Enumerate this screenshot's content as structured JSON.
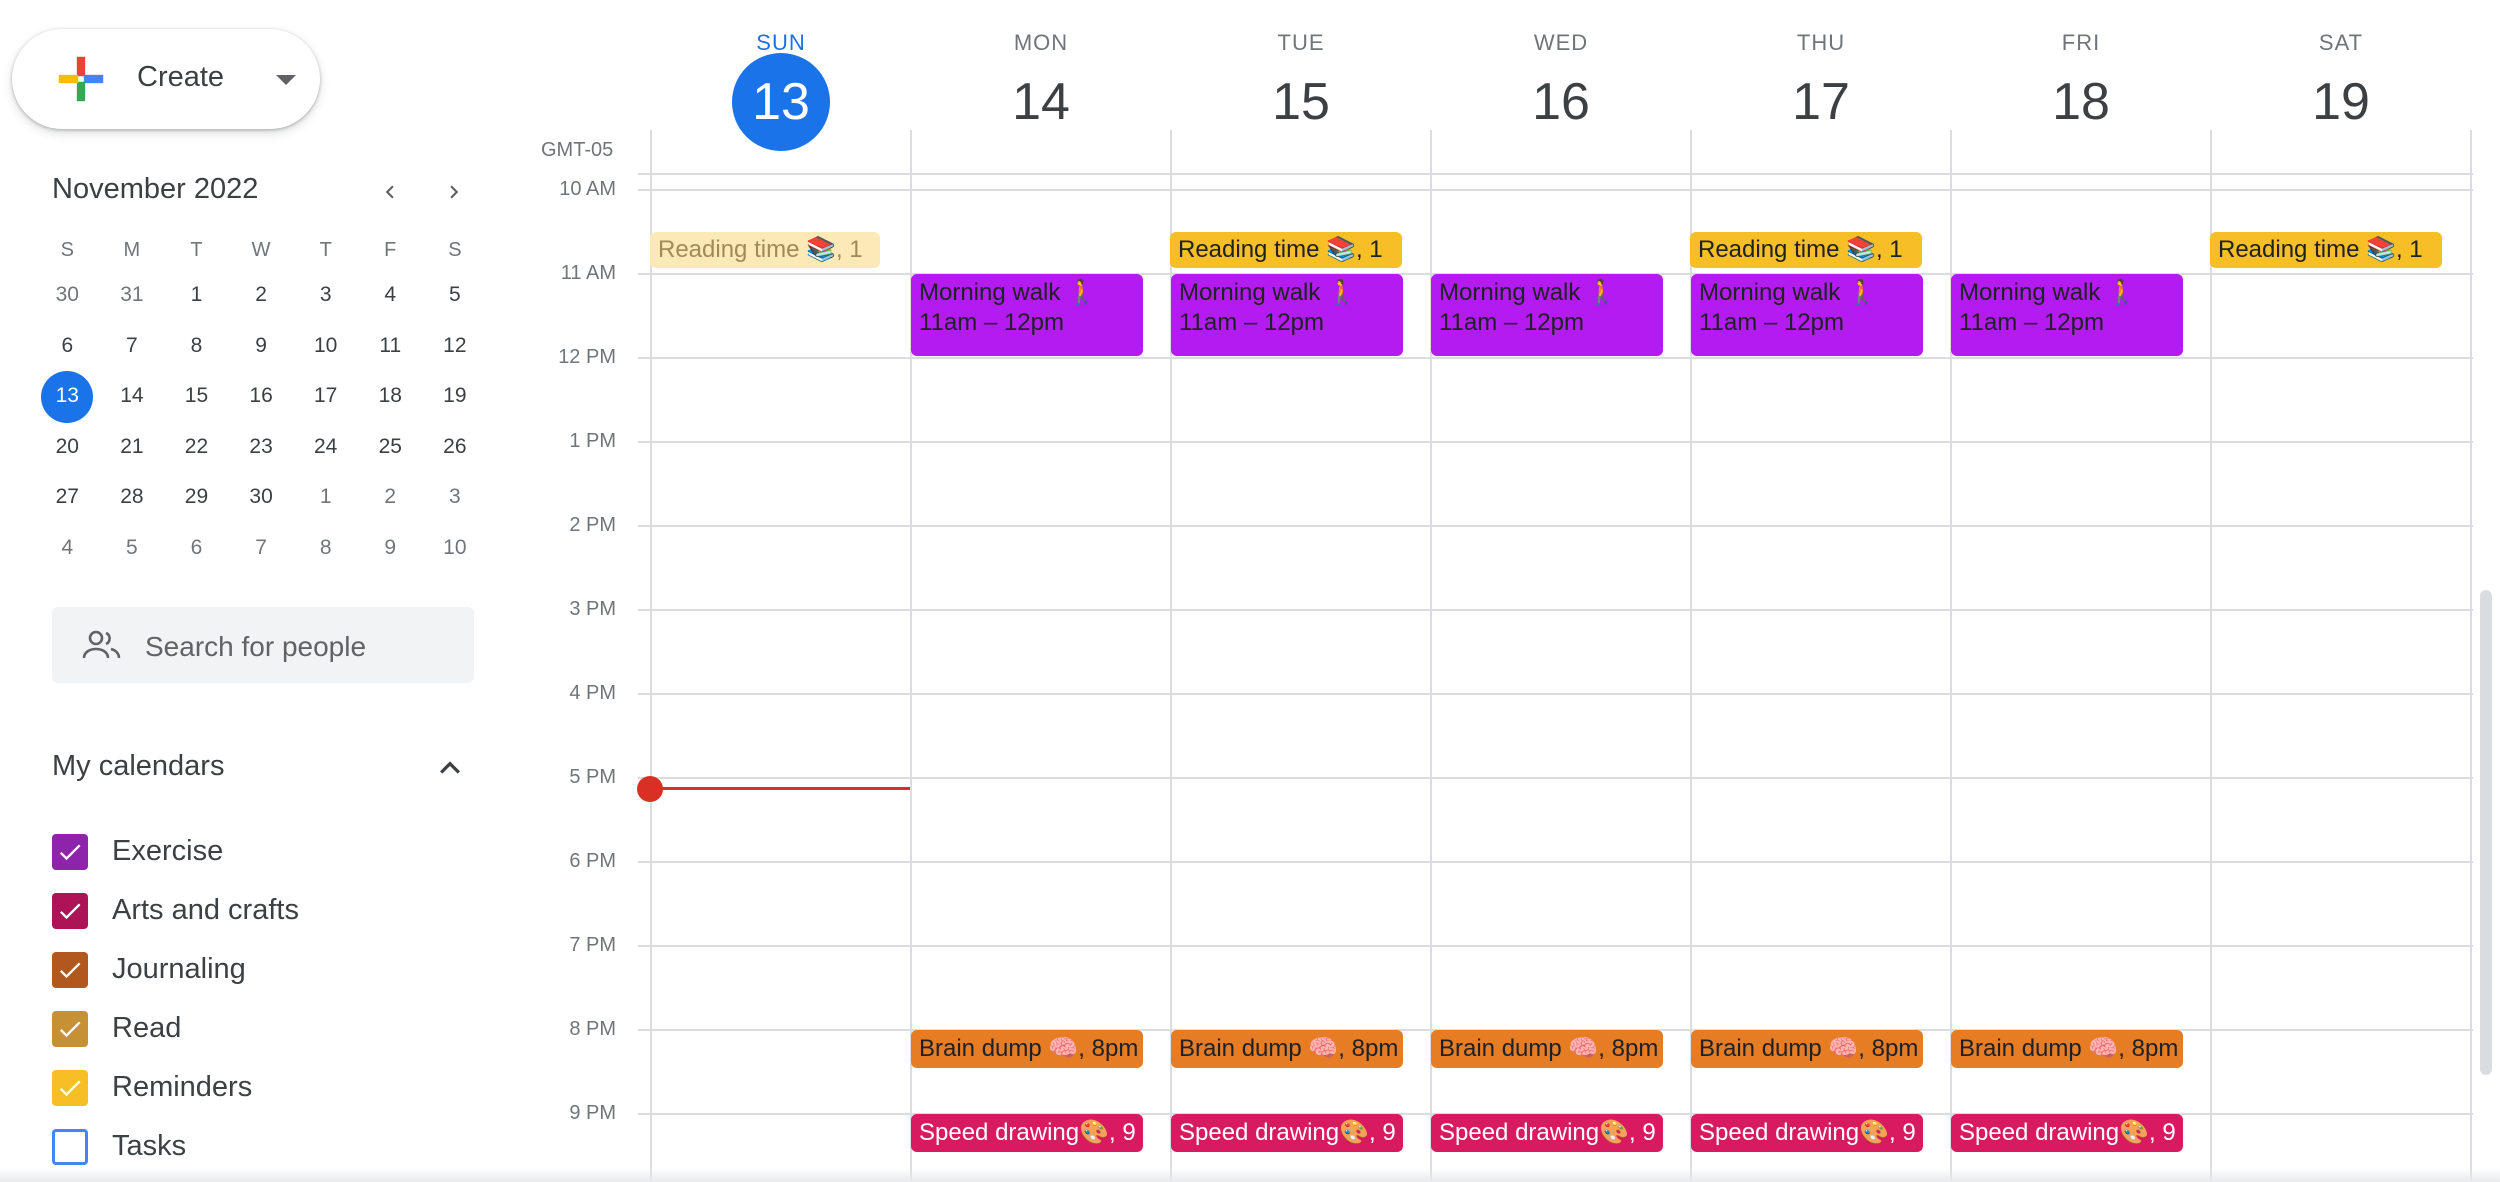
{
  "sidebar": {
    "create_label": "Create",
    "mini_calendar": {
      "title": "November 2022",
      "weekday_headers": [
        "S",
        "M",
        "T",
        "W",
        "T",
        "F",
        "S"
      ],
      "weeks": [
        [
          "30",
          "31",
          "1",
          "2",
          "3",
          "4",
          "5"
        ],
        [
          "6",
          "7",
          "8",
          "9",
          "10",
          "11",
          "12"
        ],
        [
          "13",
          "14",
          "15",
          "16",
          "17",
          "18",
          "19"
        ],
        [
          "20",
          "21",
          "22",
          "23",
          "24",
          "25",
          "26"
        ],
        [
          "27",
          "28",
          "29",
          "30",
          "1",
          "2",
          "3"
        ],
        [
          "4",
          "5",
          "6",
          "7",
          "8",
          "9",
          "10"
        ]
      ],
      "today": "13"
    },
    "search_people_placeholder": "Search for people",
    "my_calendars_title": "My calendars",
    "calendars": [
      {
        "name": "Exercise",
        "color": "#8e24aa",
        "checked": true
      },
      {
        "name": "Arts and crafts",
        "color": "#ad1457",
        "checked": true
      },
      {
        "name": "Journaling",
        "color": "#b0581d",
        "checked": true
      },
      {
        "name": "Read",
        "color": "#c69035",
        "checked": true
      },
      {
        "name": "Reminders",
        "color": "#f6bf26",
        "checked": true
      },
      {
        "name": "Tasks",
        "color": "#4285f4",
        "checked": false
      }
    ]
  },
  "week": {
    "timezone": "GMT-05",
    "days": [
      {
        "name": "SUN",
        "num": "13",
        "today": true
      },
      {
        "name": "MON",
        "num": "14"
      },
      {
        "name": "TUE",
        "num": "15"
      },
      {
        "name": "WED",
        "num": "16"
      },
      {
        "name": "THU",
        "num": "17"
      },
      {
        "name": "FRI",
        "num": "18"
      },
      {
        "name": "SAT",
        "num": "19"
      }
    ],
    "hours": [
      "10 AM",
      "11 AM",
      "12 PM",
      "1 PM",
      "2 PM",
      "3 PM",
      "4 PM",
      "5 PM",
      "6 PM",
      "7 PM",
      "8 PM",
      "9 PM"
    ]
  },
  "events": {
    "reading": "Reading time 📚, 1",
    "walk_title": "Morning walk 🚶",
    "walk_time": "11am – 12pm",
    "brain": "Brain dump 🧠, 8pm",
    "speed": "Speed drawing🎨, 9"
  },
  "colors": {
    "accent": "#1a73e8",
    "now_line": "#d93025",
    "walk": "#b31bf0",
    "reading": "#f6bf26",
    "brain": "#e67c24",
    "speed": "#d81b60"
  }
}
